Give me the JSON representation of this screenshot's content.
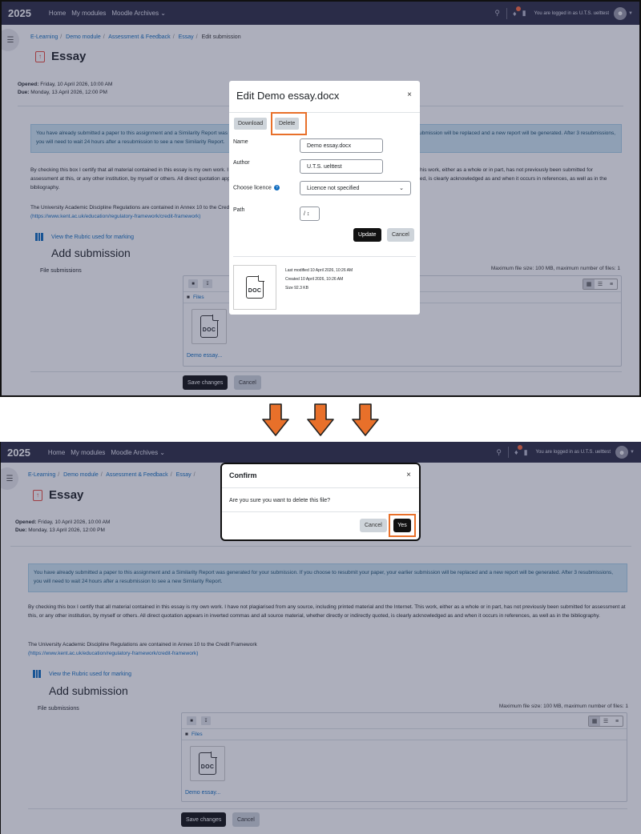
{
  "colors": {
    "nav_bg": "#2c2c45",
    "accent_orange": "#e8702a",
    "link": "#0f6cbf",
    "alert_bg": "#cfe7f4"
  },
  "nav": {
    "brand": "2025",
    "links": [
      "Home",
      "My modules",
      "Moodle Archives ⌄"
    ],
    "user_text": "You are logged in as U.T.S. uelttest",
    "icons": [
      "search-icon",
      "bell-icon",
      "chat-icon",
      "avatar"
    ]
  },
  "breadcrumb": [
    "E-Learning",
    "Demo module",
    "Assessment & Feedback",
    "Essay",
    "Edit submission"
  ],
  "page_title": "Essay",
  "dates": {
    "opened_label": "Opened:",
    "opened": "Friday, 10 April 2026, 10:00 AM",
    "due_label": "Due:",
    "due": "Monday, 13 April 2026, 12:00 PM"
  },
  "alert_text": "You have already submitted a paper to this assignment and a Similarity Report was generated for your submission. If you choose to resubmit your paper, your earlier submission will be replaced and a new report will be generated. After 3 resubmissions, you will need to wait 24 hours after a resubmission to see a new Similarity Report.",
  "statement": "By checking this box I certify that all material contained in this essay is my own work. I have not plagiarised from any source, including printed material and the Internet. This work, either as a whole or in part, has not previously been submitted for assessment at this, or any other institution, by myself or others. All direct quotation appears in inverted commas and all source material, whether directly or indirectly quoted, is clearly acknowledged as and when it occurs in references, as well as in the bibliography.",
  "regulations_line1": "The University Academic Discipline Regulations are contained in Annex 10 to the Credit Framework",
  "regulations_line2": "(https://www.kent.ac.uk/education/regulatory-framework/credit-framework)",
  "rubric_link": "View the Rubric used for marking",
  "add_submission": "Add submission",
  "file_submissions_label": "File submissions",
  "max_info": "Maximum file size: 100 MB, maximum number of files: 1",
  "filemanager": {
    "path_label": "Files",
    "file_name": "Demo essay...",
    "file_icon_text": "DOC"
  },
  "buttons": {
    "save": "Save changes",
    "cancel": "Cancel"
  },
  "edit_dialog": {
    "title": "Edit Demo essay.docx",
    "close": "×",
    "download": "Download",
    "delete": "Delete",
    "name_label": "Name",
    "name_value": "Demo essay.docx",
    "author_label": "Author",
    "author_value": "U.T.S. uelttest",
    "licence_label": "Choose licence",
    "licence_value": "Licence not specified",
    "path_label": "Path",
    "path_value": "/ ↕",
    "update": "Update",
    "cancel": "Cancel",
    "last_modified": "Last modified  10 April 2026, 10:26 AM",
    "created": "Created  10 April 2026, 10:26 AM",
    "size": "Size  92.3 KB",
    "file_icon_text": "DOC"
  },
  "confirm_dialog": {
    "title": "Confirm",
    "close": "×",
    "message": "Are you sure you want to delete this file?",
    "cancel": "Cancel",
    "yes": "Yes"
  }
}
